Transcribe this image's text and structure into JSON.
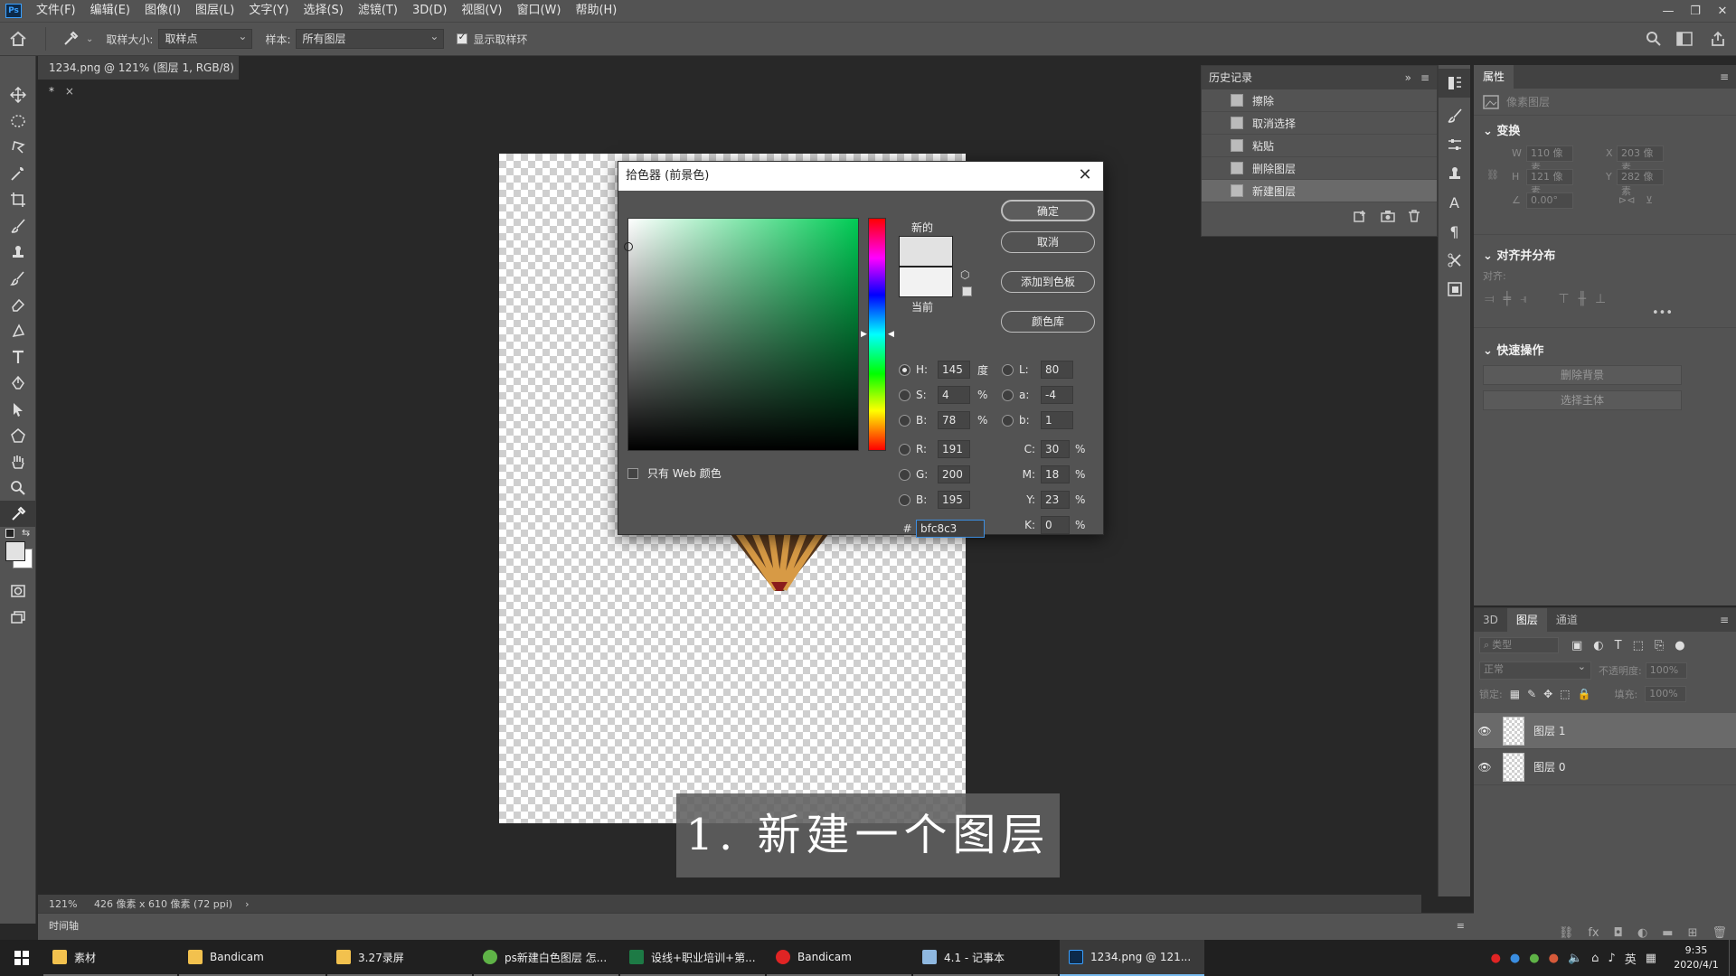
{
  "menu": [
    "文件(F)",
    "编辑(E)",
    "图像(I)",
    "图层(L)",
    "文字(Y)",
    "选择(S)",
    "滤镜(T)",
    "3D(D)",
    "视图(V)",
    "窗口(W)",
    "帮助(H)"
  ],
  "options": {
    "sample_size_label": "取样大小:",
    "sample_size_value": "取样点",
    "sample_label": "样本:",
    "sample_value": "所有图层",
    "show_ring_label": "显示取样环"
  },
  "document": {
    "tab_title": "1234.png @ 121% (图层 1, RGB/8) *",
    "zoom": "121%",
    "size_info": "426 像素 x 610 像素 (72 ppi)",
    "timeline_label": "时间轴"
  },
  "history": {
    "title": "历史记录",
    "items": [
      "擦除",
      "取消选择",
      "粘贴",
      "删除图层",
      "新建图层"
    ]
  },
  "properties": {
    "title": "属性",
    "layer_kind": "像素图层",
    "transform_title": "变换",
    "w": "110 像素",
    "h": "121 像素",
    "x": "203 像素",
    "y": "282 像素",
    "angle": "0.00°",
    "align_title": "对齐并分布",
    "align_label": "对齐:",
    "quick_title": "快速操作",
    "remove_bg": "删除背景",
    "select_subject": "选择主体"
  },
  "layers": {
    "tabs": [
      "3D",
      "图层",
      "通道"
    ],
    "kind_placeholder": "类型",
    "blend_mode": "正常",
    "opacity_label": "不透明度:",
    "opacity": "100%",
    "lock_label": "锁定:",
    "fill_label": "填充:",
    "fill": "100%",
    "items": [
      "图层 1",
      "图层 0"
    ]
  },
  "picker": {
    "title": "拾色器 (前景色)",
    "ok": "确定",
    "cancel": "取消",
    "add_swatch": "添加到色板",
    "libraries": "颜色库",
    "new_label": "新的",
    "current_label": "当前",
    "web_only": "只有 Web 颜色",
    "H": "145",
    "H_unit": "度",
    "S": "4",
    "S_unit": "%",
    "B": "78",
    "B_unit": "%",
    "R": "191",
    "G": "200",
    "B2": "195",
    "L": "80",
    "a": "-4",
    "b": "1",
    "C": "30",
    "M": "18",
    "Y": "23",
    "K": "0",
    "pct": "%",
    "hex": "bfc8c3",
    "new_color": "#e2e2e2",
    "current_color": "#f2f2f2",
    "field_hue_color": "#00cc55"
  },
  "subtitle": "1. 新建一个图层",
  "taskbar": {
    "items": [
      {
        "label": "素材",
        "color": "#f2c14e"
      },
      {
        "label": "Bandicam",
        "color": "#f2c14e"
      },
      {
        "label": "3.27录屏",
        "color": "#f2c14e"
      },
      {
        "label": "ps新建白色图层 怎...",
        "color": "#5fb347"
      },
      {
        "label": "设线+职业培训+第...",
        "color": "#1d7a45"
      },
      {
        "label": "Bandicam",
        "color": "#e02424"
      },
      {
        "label": "4.1 - 记事本",
        "color": "#8fb8e0"
      },
      {
        "label": "1234.png @ 121...",
        "color": "#0c2a4a"
      }
    ],
    "ime": "英",
    "time": "9:35",
    "date": "2020/4/1"
  }
}
